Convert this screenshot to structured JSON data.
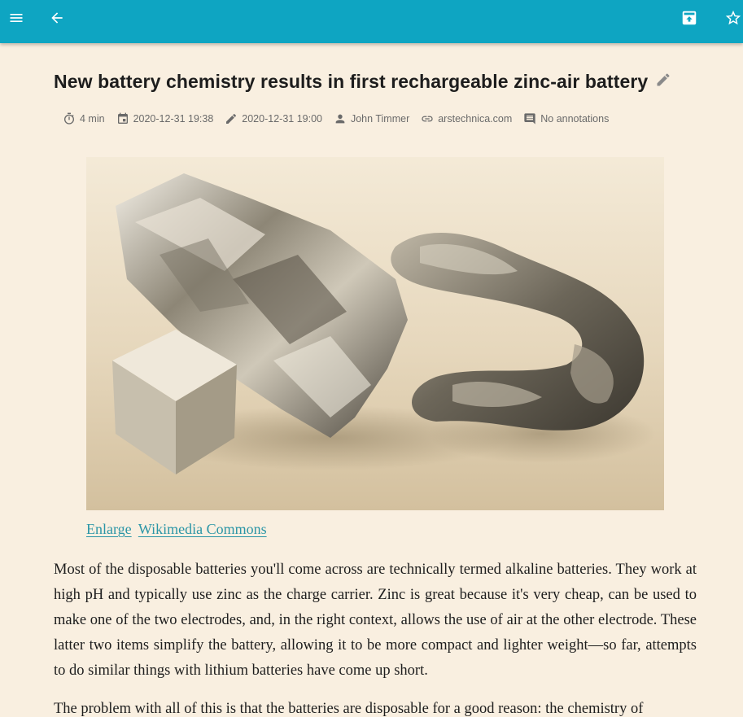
{
  "toolbar": {
    "menu_icon": "menu-icon",
    "back_icon": "arrow-back-icon",
    "archive_icon": "archive-icon",
    "star_icon": "star-outline-icon",
    "color": "#0ea5c2"
  },
  "article": {
    "title": "New battery chemistry results in first rechargeable zinc-air battery",
    "meta": {
      "reading_time": "4 min",
      "created": "2020-12-31 19:38",
      "updated": "2020-12-31 19:00",
      "author": "John Timmer",
      "domain": "arstechnica.com",
      "annotations": "No annotations"
    },
    "caption_links": [
      "Enlarge",
      "Wikimedia Commons"
    ],
    "paragraphs": [
      "Most of the disposable batteries you'll come across are technically termed alkaline batteries. They work at high pH and typically use zinc as the charge carrier. Zinc is great because it's very cheap, can be used to make one of the two electrodes, and, in the right context, allows the use of air at the other electrode. These latter two items simplify the battery, allowing it to be more compact and lighter weight—so far, attempts to do similar things with lithium batteries have come up short.",
      "The problem with all of this is that the batteries are disposable for a good reason: the chemistry of"
    ]
  },
  "colors": {
    "background": "#f9efe0",
    "link": "#2a95a6",
    "meta_text": "#6a6a6a"
  }
}
